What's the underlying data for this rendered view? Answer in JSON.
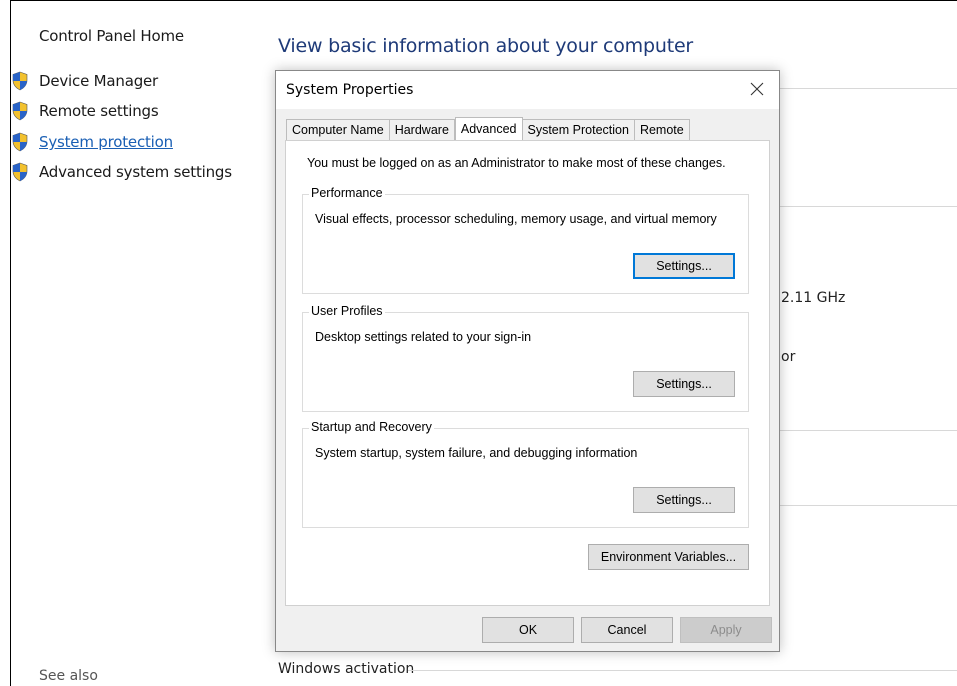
{
  "nav": {
    "home": "Control Panel Home",
    "items": [
      {
        "label": "Device Manager"
      },
      {
        "label": "Remote settings"
      },
      {
        "label": "System protection"
      },
      {
        "label": "Advanced system settings"
      }
    ],
    "see_also": "See also"
  },
  "main": {
    "title": "View basic information about your computer",
    "fragment_speed": "2.11 GHz",
    "fragment_or": "or",
    "windows_activation": "Windows activation"
  },
  "dialog": {
    "title": "System Properties",
    "tabs": [
      "Computer Name",
      "Hardware",
      "Advanced",
      "System Protection",
      "Remote"
    ],
    "active_tab": "Advanced",
    "admin_note": "You must be logged on as an Administrator to make most of these changes.",
    "performance": {
      "legend": "Performance",
      "desc": "Visual effects, processor scheduling, memory usage, and virtual memory",
      "button": "Settings..."
    },
    "user_profiles": {
      "legend": "User Profiles",
      "desc": "Desktop settings related to your sign-in",
      "button": "Settings..."
    },
    "startup_recovery": {
      "legend": "Startup and Recovery",
      "desc": "System startup, system failure, and debugging information",
      "button": "Settings..."
    },
    "env_button": "Environment Variables...",
    "ok": "OK",
    "cancel": "Cancel",
    "apply": "Apply"
  },
  "colors": {
    "link": "#1a5fb4",
    "title": "#1e3a78",
    "focus": "#0078d7",
    "shield_blue": "#2a64c8",
    "shield_yellow": "#f2c12e"
  }
}
